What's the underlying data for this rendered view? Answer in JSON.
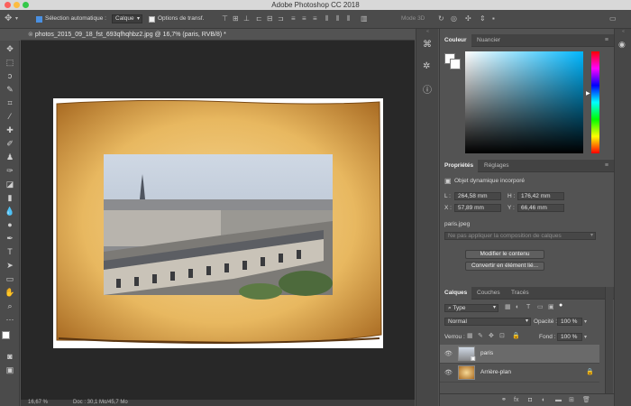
{
  "app": {
    "title": "Adobe Photoshop CC 2018"
  },
  "options_bar": {
    "auto_select_label": "Sélection automatique :",
    "auto_select_checked": true,
    "auto_select_target": "Calque",
    "transform_options_label": "Options de transf.",
    "transform_options_checked": false,
    "mode_3d_label": "Mode 3D"
  },
  "document": {
    "tab_title": "photos_2015_09_18_fst_693qfhqhbz2.jpg @ 16,7% (paris, RVB/8) *",
    "zoom": "16,67 %",
    "doc_info": "Doc : 30,1 Mo/45,7 Mo"
  },
  "color_panel": {
    "tabs": [
      "Couleur",
      "Nuancier"
    ],
    "active_tab": "Couleur",
    "hue_color": "#00b7ff"
  },
  "properties_panel": {
    "tabs": [
      "Propriétés",
      "Réglages"
    ],
    "active_tab": "Propriétés",
    "object_type": "Objet dynamique incorporé",
    "L_label": "L :",
    "L_value": "264,58 mm",
    "H_label": "H :",
    "H_value": "176,42 mm",
    "X_label": "X :",
    "X_value": "57,89 mm",
    "Y_label": "Y :",
    "Y_value": "66,46 mm",
    "source_file": "paris.jpeg",
    "layer_comp_placeholder": "Ne pas appliquer la composition de calques",
    "edit_contents_button": "Modifier le contenu",
    "convert_button": "Convertir en élément lié..."
  },
  "layers_panel": {
    "tabs": [
      "Calques",
      "Couches",
      "Tracés"
    ],
    "active_tab": "Calques",
    "filter_type": "Type",
    "blend_mode": "Normal",
    "opacity_label": "Opacité :",
    "opacity_value": "100 %",
    "lock_label": "Verrou :",
    "fill_label": "Fond :",
    "fill_value": "100 %",
    "layers": [
      {
        "name": "paris",
        "visible": true,
        "selected": true,
        "locked": false
      },
      {
        "name": "Arrière-plan",
        "visible": true,
        "selected": false,
        "locked": true
      }
    ]
  }
}
